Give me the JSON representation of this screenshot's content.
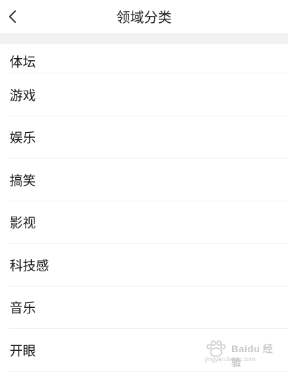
{
  "nav": {
    "title": "领域分类",
    "back_icon": "chevron-left-icon"
  },
  "categories": [
    {
      "label": "体坛"
    },
    {
      "label": "游戏"
    },
    {
      "label": "娱乐"
    },
    {
      "label": "搞笑"
    },
    {
      "label": "影视"
    },
    {
      "label": "科技感"
    },
    {
      "label": "音乐"
    },
    {
      "label": "开眼"
    }
  ],
  "watermark": {
    "brand": "Baidu 经验",
    "url": "jingyan.baidu.com"
  },
  "colors": {
    "title": "#222222",
    "item_text": "#1a1a1a",
    "band": "#f2f2f2",
    "separator": "#ececec"
  }
}
